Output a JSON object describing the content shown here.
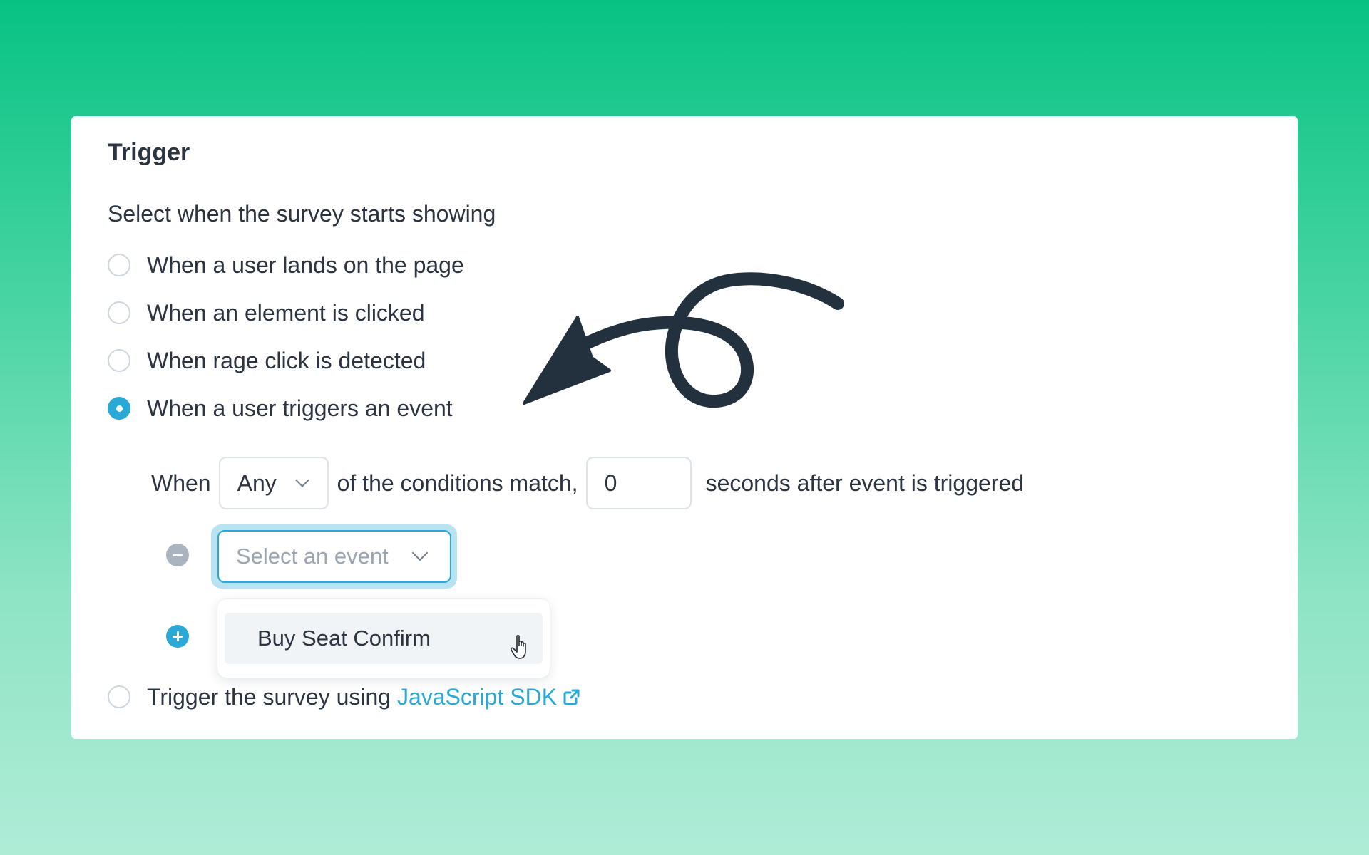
{
  "section": {
    "title": "Trigger",
    "subtitle": "Select when the survey starts showing"
  },
  "options": [
    {
      "label": "When a user lands on the page",
      "checked": false
    },
    {
      "label": "When an element is clicked",
      "checked": false
    },
    {
      "label": "When rage click is detected",
      "checked": false
    },
    {
      "label": "When a user triggers an event",
      "checked": true
    }
  ],
  "condition": {
    "prefix": "When",
    "match_value": "Any",
    "middle": "of the conditions match,",
    "seconds_value": "0",
    "suffix": "seconds after event is triggered"
  },
  "event_select": {
    "placeholder": "Select an event",
    "options": [
      "Buy Seat Confirm"
    ]
  },
  "sdk_option": {
    "prefix": "Trigger the survey using",
    "link_text": "JavaScript SDK",
    "checked": false
  },
  "colors": {
    "accent": "#2aa8d6",
    "background_top": "#08c283",
    "background_bottom": "#afecd7"
  },
  "icons": [
    "minus-circle-icon",
    "plus-circle-icon",
    "chevron-down-icon",
    "external-link-icon",
    "pointer-hand-icon",
    "hand-drawn-arrow"
  ]
}
